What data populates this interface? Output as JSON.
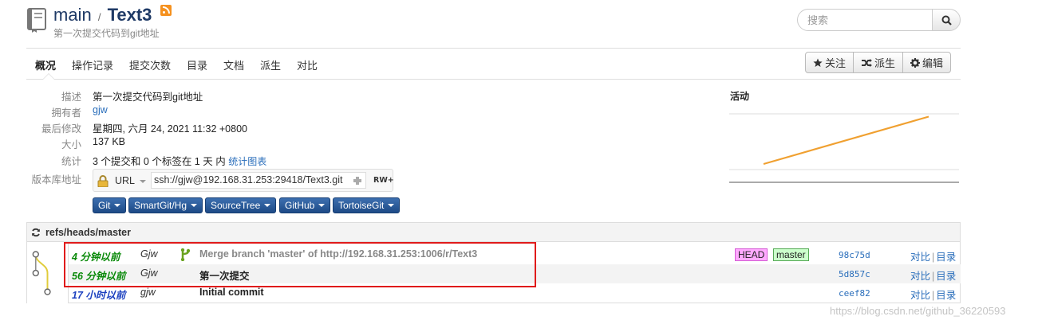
{
  "header": {
    "project": "main",
    "separator": "/",
    "repo_name": "Text3",
    "subtitle": "第一次提交代码到git地址"
  },
  "search": {
    "placeholder": "搜索"
  },
  "tabs": [
    {
      "label": "概况",
      "active": true
    },
    {
      "label": "操作记录"
    },
    {
      "label": "提交次数"
    },
    {
      "label": "目录"
    },
    {
      "label": "文档"
    },
    {
      "label": "派生"
    },
    {
      "label": "对比"
    }
  ],
  "actions": {
    "watch": "关注",
    "fork": "派生",
    "edit": "编辑"
  },
  "info": {
    "description_label": "描述",
    "description": "第一次提交代码到git地址",
    "owner_label": "拥有者",
    "owner": "gjw",
    "modified_label": "最后修改",
    "modified": "星期四, 六月 24, 2021 11:32 +0800",
    "size_label": "大小",
    "size": "137 KB",
    "stats_label": "统计",
    "stats": "3 个提交和 0 个标签在 1 天 内",
    "stats_link": "统计图表",
    "url_label": "版本库地址"
  },
  "repo_url": {
    "protocol": "URL",
    "value": "ssh://gjw@192.168.31.253:29418/Text3.git",
    "permission": "RW+"
  },
  "clients": [
    "Git",
    "SmartGit/Hg",
    "SourceTree",
    "GitHub",
    "TortoiseGit"
  ],
  "activity": {
    "title": "活动",
    "trend": [
      0.1,
      0.95
    ]
  },
  "log": {
    "ref": "refs/heads/master",
    "commits": [
      {
        "time": "4 分钟以前",
        "time_color": "#0a8a0a",
        "author": "Gjw",
        "message": "Merge branch 'master' of http://192.168.31.253:1006/r/Text3",
        "merge": true,
        "head_badge": "HEAD",
        "branch_badge": "master",
        "hash": "98c75d",
        "compare": "对比",
        "tree": "目录"
      },
      {
        "time": "56 分钟以前",
        "time_color": "#0a8a0a",
        "author": "Gjw",
        "message": "第一次提交",
        "merge": false,
        "hash": "5d857c",
        "compare": "对比",
        "tree": "目录"
      },
      {
        "time": "17 小时以前",
        "time_color": "#1a3fbf",
        "author": "gjw",
        "message": "Initial commit",
        "merge": false,
        "hash": "ceef82",
        "compare": "对比",
        "tree": "目录"
      }
    ]
  },
  "watermark": "https://blog.csdn.net/github_36220593",
  "colors": {
    "accent": "#2a6ebb",
    "client_button": "#1d4a86",
    "highlight": "#e01b1b"
  }
}
